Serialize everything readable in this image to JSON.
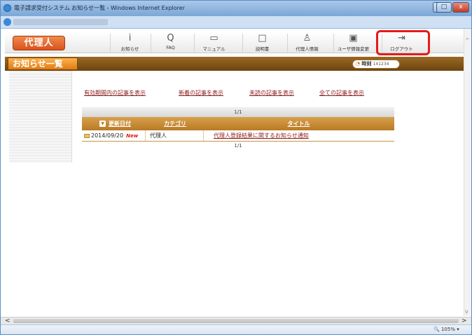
{
  "window": {
    "title": "電子請求受付システム お知らせ一覧 - Windows Internet Explorer",
    "controls": {
      "minimize": "–",
      "maximize": "□",
      "close": "x"
    }
  },
  "toolbar": {
    "role_button": "代理人",
    "items": [
      {
        "icon": "i",
        "label": "お知らせ"
      },
      {
        "icon": "Q",
        "label": "FAQ"
      },
      {
        "icon": "▭",
        "label": "マニュアル"
      },
      {
        "icon": "□",
        "label": "説明書"
      },
      {
        "icon": "♙",
        "label": "代理人情報"
      },
      {
        "icon": "▣",
        "label": "ユーザ情報変更"
      },
      {
        "icon": "⇥",
        "label": "ログアウト"
      }
    ]
  },
  "tabbar": {
    "title": "お知らせ一覧",
    "clock_icon": "◔",
    "clock_label": "時刻",
    "clock_value": "141234"
  },
  "filters": [
    "有効期間内の記事を表示",
    "新着の記事を表示",
    "未読の記事を表示",
    "全ての記事を表示"
  ],
  "grid": {
    "pager_top": "1/1",
    "pager_bottom": "1/1",
    "sort_icon": "▼",
    "columns": {
      "date": "更新日付",
      "category": "カテゴリ",
      "title": "タイトル"
    },
    "rows": [
      {
        "date": "2014/09/20",
        "badge": "New",
        "category": "代理人",
        "title": "代理人登録結果に関するお知らせ通知"
      }
    ]
  },
  "scrollbar": {
    "up": "^",
    "down": "v",
    "left": "<",
    "right": ">"
  },
  "status": {
    "zoom_icon": "🔍",
    "zoom": "105%",
    "zoom_menu": "▾"
  }
}
